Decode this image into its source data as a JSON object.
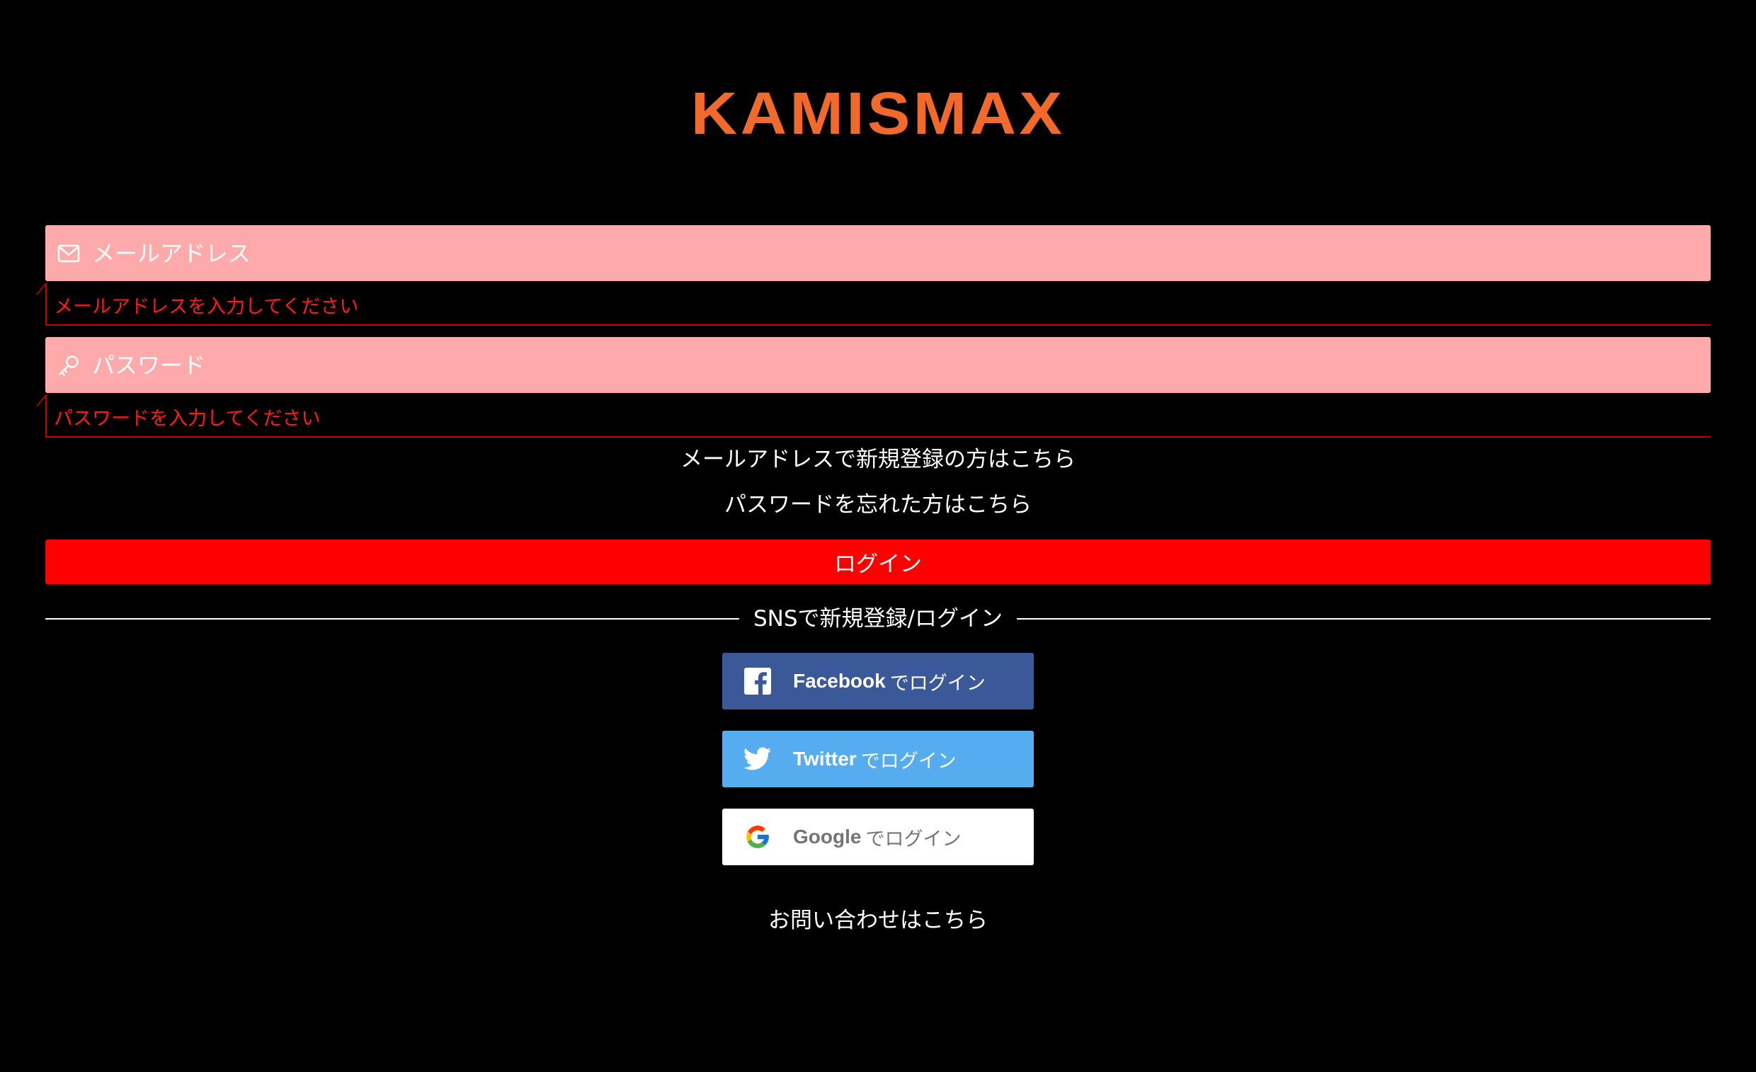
{
  "brand": {
    "logo_text": "KAMISMAX",
    "logo_color": "#f26a2b"
  },
  "colors": {
    "background": "#000000",
    "field_error_bg": "#ffaaaa",
    "error_text": "#ff1a1a",
    "login_button": "#ff0000",
    "facebook": "#3b5998",
    "twitter": "#55acee",
    "google_bg": "#ffffff",
    "google_text": "#757575"
  },
  "form": {
    "email": {
      "icon": "envelope-icon",
      "placeholder": "メールアドレス",
      "value": "",
      "error": "メールアドレスを入力してください"
    },
    "password": {
      "icon": "key-icon",
      "placeholder": "パスワード",
      "value": "",
      "error": "パスワードを入力してください"
    }
  },
  "links": {
    "register_email": "メールアドレスで新規登録の方はこちら",
    "forgot_password": "パスワードを忘れた方はこちら",
    "contact": "お問い合わせはこちら"
  },
  "login_button_label": "ログイン",
  "sns": {
    "divider_label": "SNSで新規登録/ログイン",
    "facebook": {
      "icon": "facebook-icon",
      "brand": "Facebook",
      "suffix": "でログイン"
    },
    "twitter": {
      "icon": "twitter-icon",
      "brand": "Twitter",
      "suffix": "でログイン"
    },
    "google": {
      "icon": "google-icon",
      "brand": "Google",
      "suffix": "でログイン"
    }
  }
}
